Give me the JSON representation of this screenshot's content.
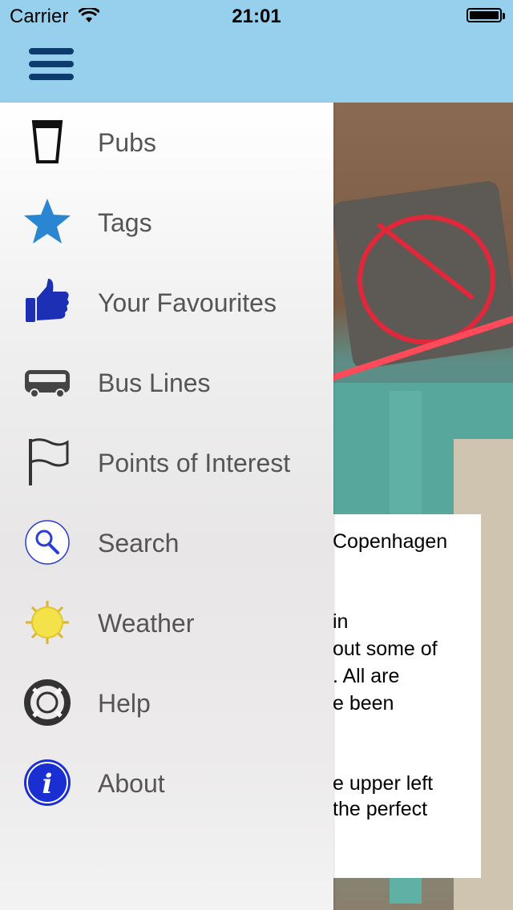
{
  "status_bar": {
    "carrier": "Carrier",
    "time": "21:01"
  },
  "menu": [
    {
      "label": "Pubs",
      "icon": "pint-glass-icon"
    },
    {
      "label": "Tags",
      "icon": "star-icon"
    },
    {
      "label": "Your Favourites",
      "icon": "thumbs-up-icon"
    },
    {
      "label": "Bus Lines",
      "icon": "bus-icon"
    },
    {
      "label": "Points of Interest",
      "icon": "flag-icon"
    },
    {
      "label": "Search",
      "icon": "search-icon"
    },
    {
      "label": "Weather",
      "icon": "sun-icon"
    },
    {
      "label": "Help",
      "icon": "lifebuoy-icon"
    },
    {
      "label": "About",
      "icon": "info-icon"
    }
  ],
  "card": {
    "lines": [
      "Copenhagen",
      "in",
      "out some of",
      ". All are",
      "e been",
      "e upper left",
      "the perfect"
    ]
  },
  "colors": {
    "nav_bar": "#97d0ec",
    "menu_button": "#0d3b6e",
    "star": "#2a86d1",
    "thumb": "#1d2fb4",
    "info": "#1a2fd1"
  }
}
